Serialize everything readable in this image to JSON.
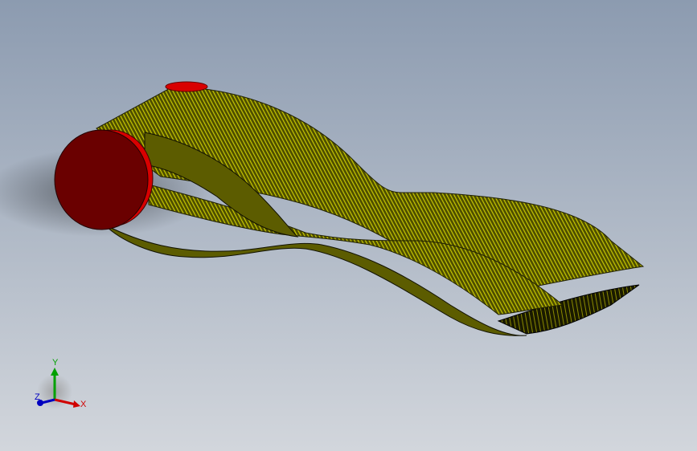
{
  "viewport": {
    "background_top": "#8c9bb0",
    "background_bottom": "#d2d6dc"
  },
  "model": {
    "belt_color": "#5a5a00",
    "belt_edge_color": "#d6d600",
    "pulley_face_color": "#6e0000",
    "pulley_rim_color": "#e00000"
  },
  "triad": {
    "x_label": "X",
    "y_label": "Y",
    "z_label": "Z",
    "x_color": "#d00000",
    "y_color": "#00a000",
    "z_color": "#0000c0"
  }
}
